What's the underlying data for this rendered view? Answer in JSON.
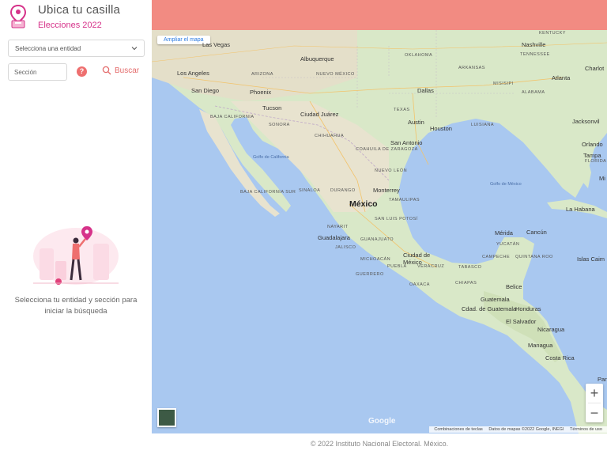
{
  "brand": {
    "title": "Ubica tu casilla",
    "subtitle": "Elecciones 2022"
  },
  "filters": {
    "entity_placeholder": "Selecciona una entidad",
    "section_placeholder": "Sección",
    "help_symbol": "?",
    "search_label": "Buscar"
  },
  "empty_state": {
    "message": "Selecciona tu entidad y sección para iniciar la búsqueda"
  },
  "map": {
    "enlarge_label": "Ampliar el mapa",
    "zoom_in": "+",
    "zoom_out": "−",
    "google": "Google",
    "attribution": [
      "Combinaciones de teclas",
      "Datos de mapas ©2022 Google, INEGI",
      "Términos de uso"
    ],
    "labels": [
      {
        "text": "Las Vegas",
        "kind": "city"
      },
      {
        "text": "Albuquerque",
        "kind": "city"
      },
      {
        "text": "OKLAHOMA",
        "kind": "state"
      },
      {
        "text": "KENTUCKY",
        "kind": "state"
      },
      {
        "text": "Nashville",
        "kind": "city"
      },
      {
        "text": "TENNESSEE",
        "kind": "state"
      },
      {
        "text": "Los Angeles",
        "kind": "city"
      },
      {
        "text": "ARIZONA",
        "kind": "state"
      },
      {
        "text": "NUEVO MÉXICO",
        "kind": "state"
      },
      {
        "text": "ARKANSAS",
        "kind": "state"
      },
      {
        "text": "Atlanta",
        "kind": "city"
      },
      {
        "text": "Charlot",
        "kind": "city"
      },
      {
        "text": "San Diego",
        "kind": "city"
      },
      {
        "text": "Phoenix",
        "kind": "city"
      },
      {
        "text": "Dallas",
        "kind": "city"
      },
      {
        "text": "MISISIPI",
        "kind": "state"
      },
      {
        "text": "ALABAMA",
        "kind": "state"
      },
      {
        "text": "Tucson",
        "kind": "city"
      },
      {
        "text": "TEXAS",
        "kind": "state"
      },
      {
        "text": "Ciudad Juárez",
        "kind": "city"
      },
      {
        "text": "BAJA CALIFORNIA",
        "kind": "state"
      },
      {
        "text": "SONORA",
        "kind": "state"
      },
      {
        "text": "Austin",
        "kind": "city"
      },
      {
        "text": "Houston",
        "kind": "city"
      },
      {
        "text": "LUISIANA",
        "kind": "state"
      },
      {
        "text": "Jacksonvil",
        "kind": "city"
      },
      {
        "text": "CHIHUAHUA",
        "kind": "state"
      },
      {
        "text": "San Antonio",
        "kind": "city"
      },
      {
        "text": "Orlando",
        "kind": "city"
      },
      {
        "text": "COAHUILA DE ZARAGOZA",
        "kind": "state"
      },
      {
        "text": "Golfo de California",
        "kind": "sea"
      },
      {
        "text": "Tampa",
        "kind": "city"
      },
      {
        "text": "FLORIDA",
        "kind": "state"
      },
      {
        "text": "NUEVO LEÓN",
        "kind": "state"
      },
      {
        "text": "Golfo de México",
        "kind": "sea"
      },
      {
        "text": "Mi",
        "kind": "city"
      },
      {
        "text": "BAJA CALIFORNIA SUR",
        "kind": "state"
      },
      {
        "text": "SINALOA",
        "kind": "state"
      },
      {
        "text": "DURANGO",
        "kind": "state"
      },
      {
        "text": "Monterrey",
        "kind": "city"
      },
      {
        "text": "TAMAULIPAS",
        "kind": "state"
      },
      {
        "text": "México",
        "kind": "big"
      },
      {
        "text": "La Habana",
        "kind": "city"
      },
      {
        "text": "SAN LUIS POTOSÍ",
        "kind": "state"
      },
      {
        "text": "NAYARIT",
        "kind": "state"
      },
      {
        "text": "Mérida",
        "kind": "city"
      },
      {
        "text": "Cancún",
        "kind": "city"
      },
      {
        "text": "Guadalajara",
        "kind": "city"
      },
      {
        "text": "GUANAJUATO",
        "kind": "state"
      },
      {
        "text": "YUCATÁN",
        "kind": "state"
      },
      {
        "text": "JALISCO",
        "kind": "state"
      },
      {
        "text": "Ciudad de",
        "kind": "city"
      },
      {
        "text": "México",
        "kind": "city"
      },
      {
        "text": "MICHOACÁN",
        "kind": "state"
      },
      {
        "text": "CAMPECHE",
        "kind": "state"
      },
      {
        "text": "QUINTANA ROO",
        "kind": "state"
      },
      {
        "text": "Islas Caim",
        "kind": "city"
      },
      {
        "text": "PUEBLA",
        "kind": "state"
      },
      {
        "text": "VERACRUZ",
        "kind": "state"
      },
      {
        "text": "TABASCO",
        "kind": "state"
      },
      {
        "text": "GUERRERO",
        "kind": "state"
      },
      {
        "text": "OAXACA",
        "kind": "state"
      },
      {
        "text": "CHIAPAS",
        "kind": "state"
      },
      {
        "text": "Belice",
        "kind": "city"
      },
      {
        "text": "Guatemala",
        "kind": "city"
      },
      {
        "text": "Honduras",
        "kind": "city"
      },
      {
        "text": "Cdad. de Guatemala",
        "kind": "city"
      },
      {
        "text": "El Salvador",
        "kind": "city"
      },
      {
        "text": "Nicaragua",
        "kind": "city"
      },
      {
        "text": "Managua",
        "kind": "city"
      },
      {
        "text": "Costa Rica",
        "kind": "city"
      },
      {
        "text": "Pan",
        "kind": "city"
      }
    ]
  },
  "footer": {
    "text": "© 2022 Instituto Nacional Electoral. México."
  },
  "colors": {
    "accent": "#d6338a",
    "topbar": "#f28b82",
    "search": "#e46c6c",
    "water": "#a9c8f0",
    "land": "#d9e8c8"
  }
}
